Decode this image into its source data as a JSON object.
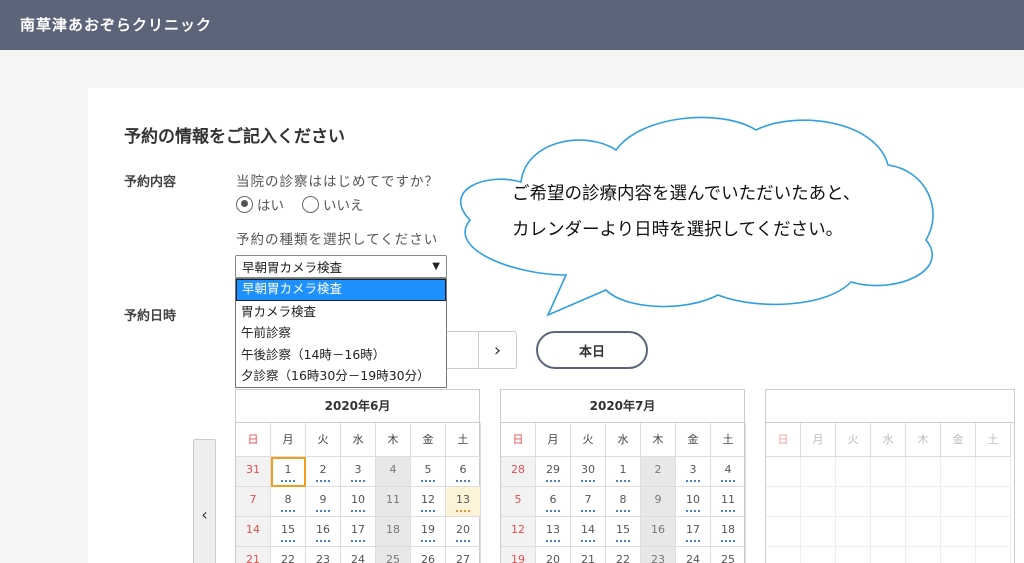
{
  "header": {
    "title": "南草津あおぞらクリニック"
  },
  "form": {
    "section_title": "予約の情報をご記入ください",
    "label_content": "予約内容",
    "label_datetime": "予約日時",
    "first_visit_question": "当院の診察ははじめてですか？",
    "radio_yes": "はい",
    "radio_no": "いいえ",
    "radio_selected": "はい",
    "type_question": "予約の種類を選択してください",
    "select_value": "早朝胃カメラ検査",
    "options": [
      "早朝胃カメラ検査",
      "胃カメラ検査",
      "午前診察",
      "午後診察（14時－16時）",
      "夕診察（16時30分－19時30分）"
    ]
  },
  "nav": {
    "next_icon": "›",
    "today_label": "本日",
    "prev_icon": "‹"
  },
  "callout": {
    "line1": "ご希望の診療内容を選んでいただいたあと、",
    "line2": "カレンダーより日時を選択してください。"
  },
  "weekdays": [
    "日",
    "月",
    "火",
    "水",
    "木",
    "金",
    "土"
  ],
  "calendars": [
    {
      "title": "2020年6月",
      "weeks": [
        [
          "31",
          "1",
          "2",
          "3",
          "4",
          "5",
          "6"
        ],
        [
          "7",
          "8",
          "9",
          "10",
          "11",
          "12",
          "13"
        ],
        [
          "14",
          "15",
          "16",
          "17",
          "18",
          "19",
          "20"
        ],
        [
          "21",
          "22",
          "23",
          "24",
          "25",
          "26",
          "27"
        ]
      ]
    },
    {
      "title": "2020年7月",
      "weeks": [
        [
          "28",
          "29",
          "30",
          "1",
          "2",
          "3",
          "4"
        ],
        [
          "5",
          "6",
          "7",
          "8",
          "9",
          "10",
          "11"
        ],
        [
          "12",
          "13",
          "14",
          "15",
          "16",
          "17",
          "18"
        ],
        [
          "19",
          "20",
          "21",
          "22",
          "23",
          "24",
          "25"
        ]
      ]
    }
  ],
  "colors": {
    "header_bg": "#5b6479",
    "select_highlight": "#1e90ff",
    "sunday": "#e05050",
    "today_outline": "#f0a020",
    "slot_dots": "#4a7fc0"
  }
}
